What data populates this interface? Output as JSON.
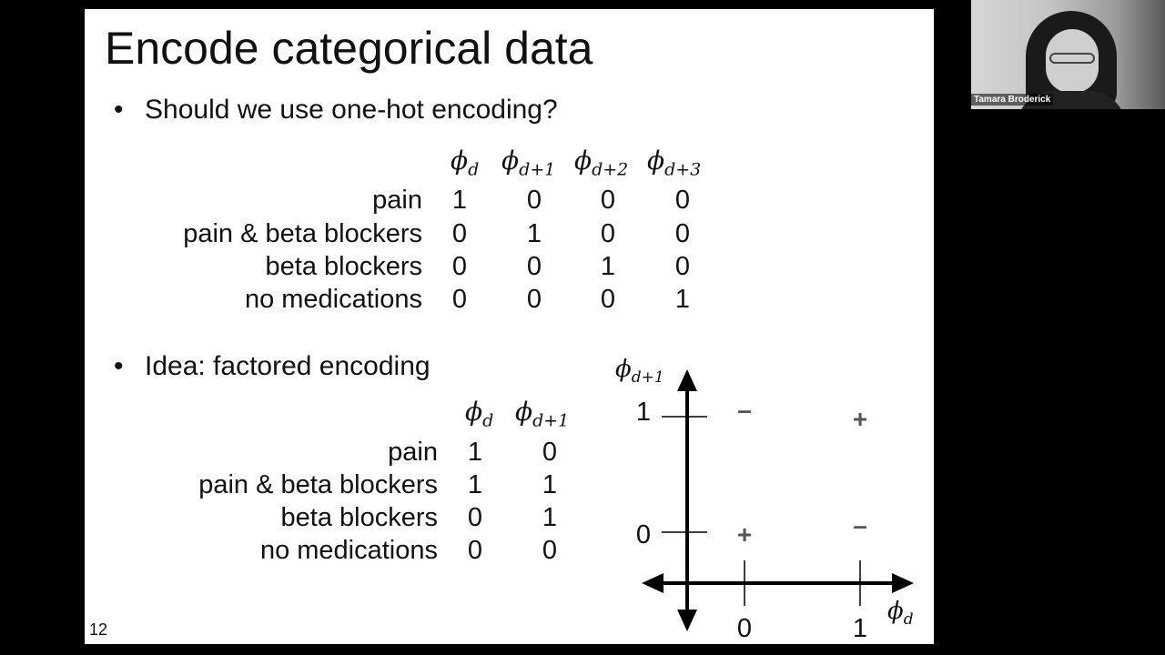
{
  "slide": {
    "title": "Encode categorical data",
    "bullet1": "Should we use one-hot encoding?",
    "bullet2": "Idea: factored encoding",
    "bullet_glyph": "•",
    "slide_number": "12"
  },
  "onehot": {
    "phi_symbol": "ϕ",
    "header_subscripts": [
      "d",
      "d+1",
      "d+2",
      "d+3"
    ],
    "rows": [
      {
        "label": "pain",
        "values": [
          "1",
          "0",
          "0",
          "0"
        ]
      },
      {
        "label": "pain & beta blockers",
        "values": [
          "0",
          "1",
          "0",
          "0"
        ]
      },
      {
        "label": "beta blockers",
        "values": [
          "0",
          "0",
          "1",
          "0"
        ]
      },
      {
        "label": "no medications",
        "values": [
          "0",
          "0",
          "0",
          "1"
        ]
      }
    ]
  },
  "factored": {
    "phi_symbol": "ϕ",
    "header_subscripts": [
      "d",
      "d+1"
    ],
    "rows": [
      {
        "label": "pain",
        "values": [
          "1",
          "0"
        ]
      },
      {
        "label": "pain & beta blockers",
        "values": [
          "1",
          "1"
        ]
      },
      {
        "label": "beta blockers",
        "values": [
          "0",
          "1"
        ]
      },
      {
        "label": "no medications",
        "values": [
          "0",
          "0"
        ]
      }
    ]
  },
  "plot": {
    "x_axis_symbol": "ϕ",
    "x_axis_sub": "d",
    "y_axis_symbol": "ϕ",
    "y_axis_sub": "d+1",
    "x_ticks": [
      "0",
      "1"
    ],
    "y_ticks": [
      "0",
      "1"
    ],
    "marks": [
      {
        "x": 0,
        "y": 1,
        "sign": "–"
      },
      {
        "x": 1,
        "y": 1,
        "sign": "+"
      },
      {
        "x": 0,
        "y": 0,
        "sign": "+"
      },
      {
        "x": 1,
        "y": 0,
        "sign": "–"
      }
    ]
  },
  "video": {
    "participant_name": "Tamara Broderick"
  }
}
